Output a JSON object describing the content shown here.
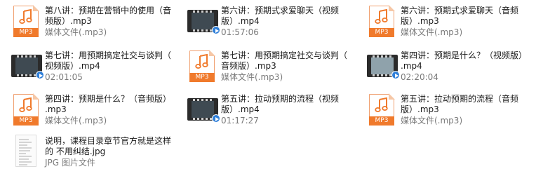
{
  "items": [
    {
      "type": "mp3",
      "name": "第八讲：预期在营销中的使用（音\n频版）.mp3",
      "meta": "媒体文件(.mp3)",
      "icon_label": "MP3"
    },
    {
      "type": "video",
      "name": "第六讲：预期式求爱聊天（视频\n版）.mp4",
      "meta": "01:57:06"
    },
    {
      "type": "mp3",
      "name": "第六讲：预期式求爱聊天（音频\n版）.mp3",
      "meta": "媒体文件(.mp3)",
      "icon_label": "MP3"
    },
    {
      "type": "video",
      "name": "第七讲：用预期搞定社交与谈判（\n视频版）.mp4",
      "meta": "02:01:05"
    },
    {
      "type": "mp3",
      "name": "第七讲：用预期搞定社交与谈判（\n音频版）.mp3",
      "meta": "媒体文件(.mp3)",
      "icon_label": "MP3"
    },
    {
      "type": "video",
      "name": "第四讲：预期是什么？（视频版）\n.mp4",
      "meta": "02:20:04"
    },
    {
      "type": "mp3",
      "name": "第四讲：预期是什么？（音频版）\n.mp3",
      "meta": "媒体文件(.mp3)",
      "icon_label": "MP3"
    },
    {
      "type": "video",
      "name": "第五讲：拉动预期的流程（视频\n版）.mp4",
      "meta": "01:17:27"
    },
    {
      "type": "mp3",
      "name": "第五讲：拉动预期的流程（音频\n版）.mp3",
      "meta": "媒体文件(.mp3)",
      "icon_label": "MP3"
    },
    {
      "type": "jpg",
      "name": "说明，课程目录章节官方就是这样\n的 不用纠结.jpg",
      "meta": "JPG 图片文件"
    }
  ]
}
